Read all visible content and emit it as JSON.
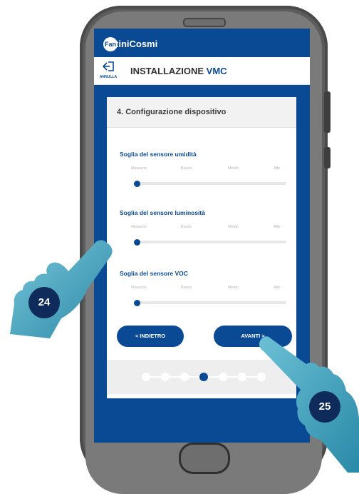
{
  "app": {
    "brand_logo_mark": "Fan",
    "brand_logo_text": "tiniCosmi"
  },
  "header": {
    "cancel_label": "ANNULLA",
    "title_prefix": "INSTALLAZIONE",
    "title_accent": "VMC",
    "cancel_icon": "exit-arrow-icon"
  },
  "card": {
    "title": "4. Configurazione dispositivo",
    "sliders": [
      {
        "label": "Soglia del sensore umidità",
        "ticks": [
          "Nessuno",
          "Basso",
          "Medio",
          "Alto"
        ],
        "value_index": 0
      },
      {
        "label": "Soglia del sensore luminosità",
        "ticks": [
          "Nessuno",
          "Basso",
          "Medio",
          "Alto"
        ],
        "value_index": 0
      },
      {
        "label": "Soglia del sensore VOC",
        "ticks": [
          "Nessuno",
          "Basso",
          "Medio",
          "Alto"
        ],
        "value_index": 0
      }
    ],
    "back_label": "< INDIETRO",
    "next_label": "AVANTI >"
  },
  "pager": {
    "total_steps": 7,
    "current_step": 4
  },
  "callouts": {
    "left_number": "24",
    "right_number": "25"
  },
  "colors": {
    "brand_blue": "#0a4a95",
    "badge_navy": "#0f2b5b",
    "hand_cyan": "#4aa9c2"
  }
}
